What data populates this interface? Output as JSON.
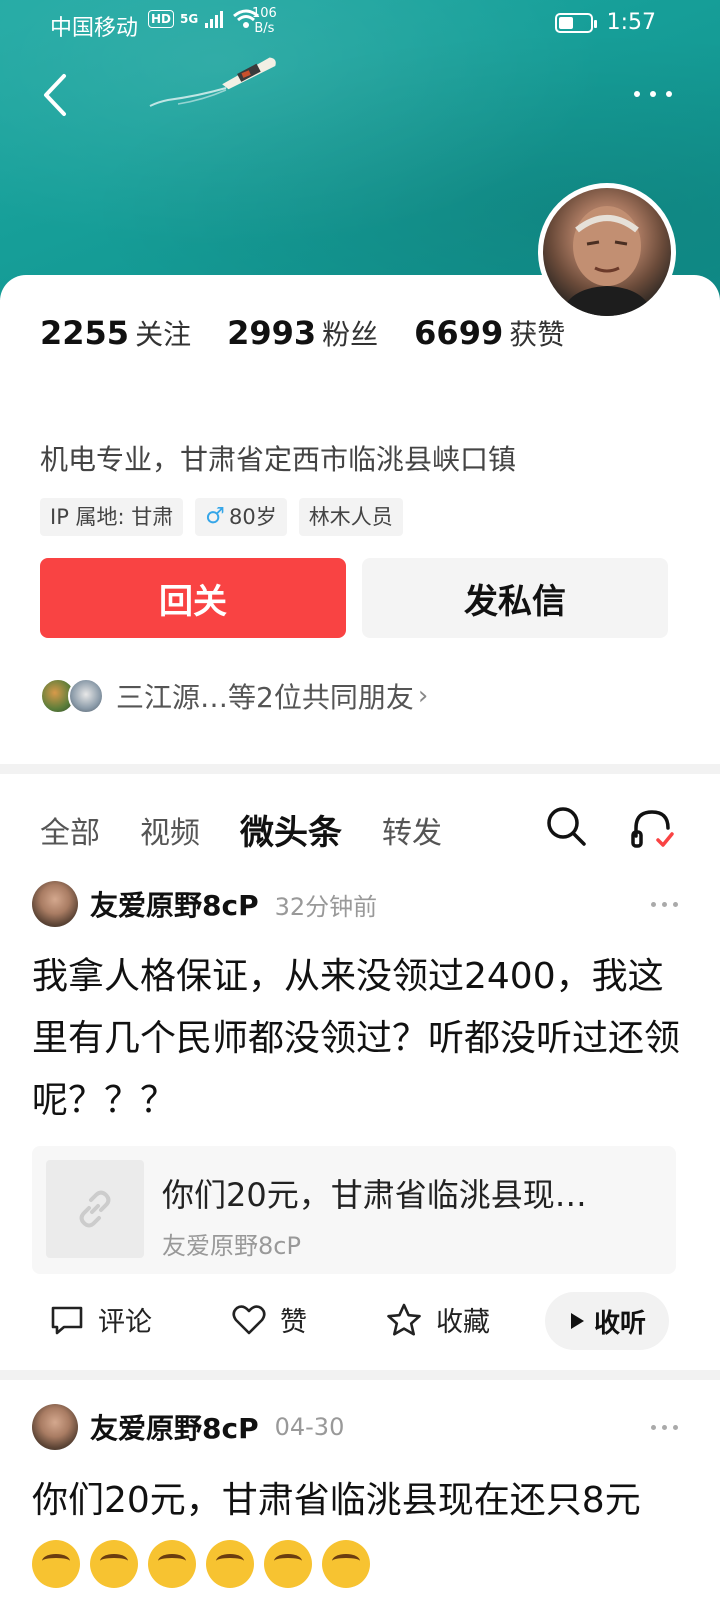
{
  "status_bar": {
    "carrier": "中国移动",
    "hd": "HD",
    "network": "5G",
    "speed_value": "106",
    "speed_unit": "B/s",
    "time": "1:57"
  },
  "profile": {
    "stats": [
      {
        "num": "2255",
        "label": "关注"
      },
      {
        "num": "2993",
        "label": "粉丝"
      },
      {
        "num": "6699",
        "label": "获赞"
      }
    ],
    "bio": "机电专业，甘肃省定西市临洮县峡口镇",
    "tags": {
      "ip": "IP 属地: 甘肃",
      "age": "80岁",
      "job": "林木人员"
    },
    "follow_label": "回关",
    "message_label": "发私信",
    "mutual_friends": "三江源…等2位共同朋友",
    "mutual_chevron": "›"
  },
  "tabs": [
    "全部",
    "视频",
    "微头条",
    "转发"
  ],
  "active_tab": "微头条",
  "posts": [
    {
      "author": "友爱原野8cP",
      "time": "32分钟前",
      "text": "我拿人格保证，从来没领过2400，我这里有几个民师都没领过？听都没听过还领呢？？？",
      "share_title": "你们20元，甘肃省临洮县现…",
      "share_author": "友爱原野8cP"
    },
    {
      "author": "友爱原野8cP",
      "time": "04-30",
      "text": "你们20元，甘肃省临洮县现在还只8元"
    }
  ],
  "actions": {
    "comment": "评论",
    "like": "赞",
    "favorite": "收藏",
    "listen": "收听"
  },
  "colors": {
    "accent": "#f94343",
    "cover": "#169e98"
  }
}
